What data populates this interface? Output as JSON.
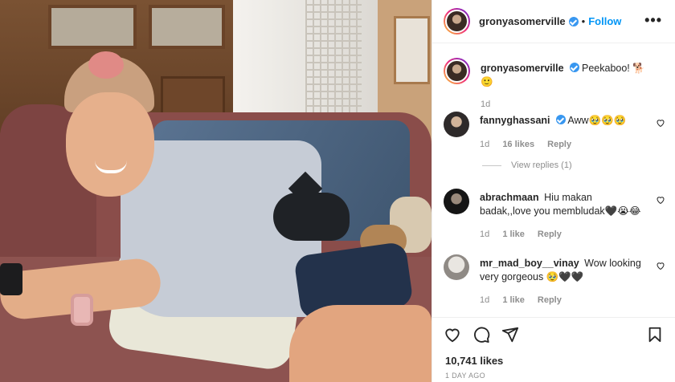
{
  "post": {
    "author": "gronyasomerville",
    "follow_label": "Follow",
    "dot": "•",
    "more": "•••"
  },
  "caption": {
    "user": "gronyasomerville",
    "text": "Peekaboo! 🐕🙂",
    "time": "1d"
  },
  "comments": [
    {
      "user": "fannyghassani",
      "verified": true,
      "text": "Aww🥹🥹🥹",
      "time": "1d",
      "likes": "16 likes",
      "reply": "Reply"
    },
    {
      "user": "abrachmaan",
      "verified": false,
      "text": "Hiu makan badak,,love you membludak🖤😭😂",
      "time": "1d",
      "likes": "1 like",
      "reply": "Reply"
    },
    {
      "user": "mr_mad_boy__vinay",
      "verified": false,
      "text": "Wow looking very gorgeous 🥹🖤🖤",
      "time": "1d",
      "likes": "1 like",
      "reply": "Reply"
    }
  ],
  "view_replies": "View replies (1)",
  "footer": {
    "likes": "10,741 likes",
    "date": "1 DAY AGO"
  },
  "icons": {
    "like": "heart-icon",
    "comment": "comment-icon",
    "share": "share-icon",
    "save": "bookmark-icon",
    "more": "more-options-icon",
    "verified": "verified-badge-icon"
  },
  "colors": {
    "accent": "#0095f6",
    "verified": "#3897f0",
    "muted": "#8e8e8e",
    "text": "#262626"
  }
}
